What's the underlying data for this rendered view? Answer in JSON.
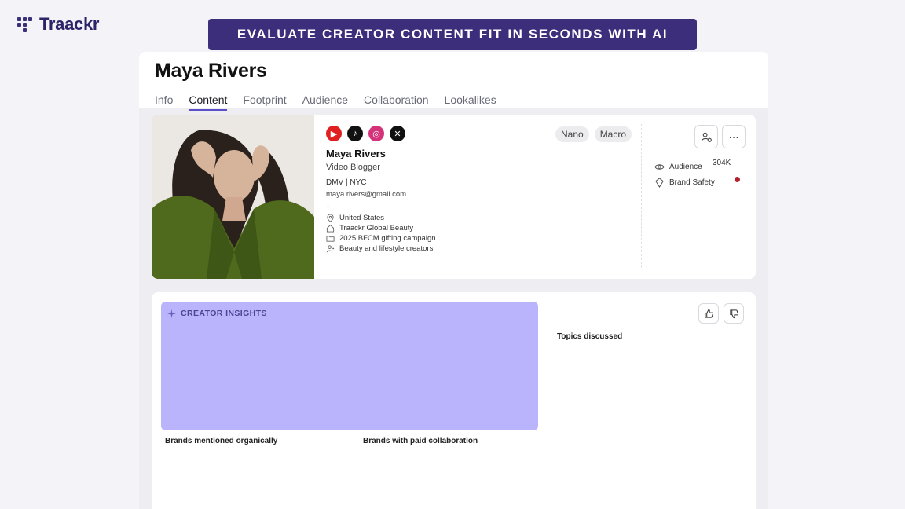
{
  "brand": {
    "name": "Traackr"
  },
  "banner": {
    "text": "EVALUATE CREATOR CONTENT FIT IN SECONDS WITH AI"
  },
  "profile": {
    "title": "Maya Rivers",
    "tabs": [
      {
        "label": "Info",
        "active": false
      },
      {
        "label": "Content",
        "active": true
      },
      {
        "label": "Footprint",
        "active": false
      },
      {
        "label": "Audience",
        "active": false
      },
      {
        "label": "Collaboration",
        "active": false
      },
      {
        "label": "Lookalikes",
        "active": false
      }
    ]
  },
  "creator": {
    "socials": [
      "youtube-icon",
      "tiktok-icon",
      "instagram-icon",
      "x-icon"
    ],
    "tags": [
      "Nano",
      "Macro"
    ],
    "name": "Maya Rivers",
    "role": "Video Blogger",
    "location_short": "DMV | NYC",
    "email": "maya.rivers@gmail.com",
    "arrow": "↓",
    "country": "United States",
    "workspace": "Traackr Global Beauty",
    "campaign": "2025 BFCM gifting campaign",
    "group": "Beauty and lifestyle creators"
  },
  "stats": {
    "audience_label": "Audience",
    "audience_value": "304K",
    "safety_label": "Brand Safety",
    "safety_color": "#b5202e"
  },
  "actions": {
    "more": "···"
  },
  "insights": {
    "label": "CREATOR INSIGHTS",
    "topics_label": "Topics discussed",
    "brands_organic_label": "Brands mentioned organically",
    "brands_paid_label": "Brands with paid collaboration"
  },
  "colors": {
    "accent": "#3d2e7c",
    "insights_panel": "#b9b4fb",
    "tab_underline": "#5b4fc5"
  }
}
